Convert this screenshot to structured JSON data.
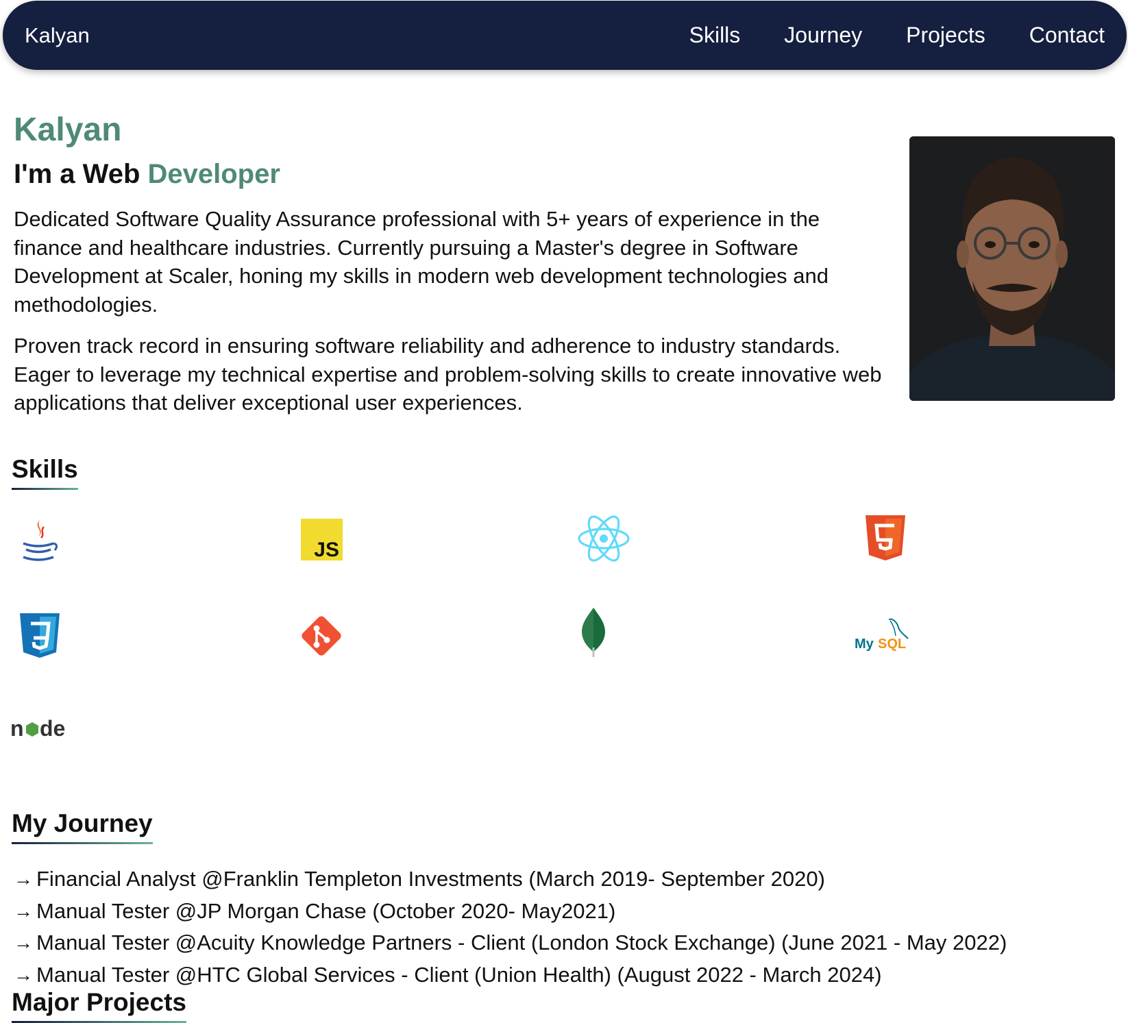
{
  "nav": {
    "brand": "Kalyan",
    "links": [
      "Skills",
      "Journey",
      "Projects",
      "Contact"
    ]
  },
  "hero": {
    "name": "Kalyan",
    "role_prefix": "I'm a Web ",
    "role_accent": "Developer",
    "bio_1": "Dedicated Software Quality Assurance professional with 5+ years of experience in the finance and healthcare industries. Currently pursuing a Master's degree in Software Development at Scaler, honing my skills in modern web development technologies and methodologies.",
    "bio_2": "Proven track record in ensuring software reliability and adherence to industry standards. Eager to leverage my technical expertise and problem-solving skills to create innovative web applications that deliver exceptional user experiences."
  },
  "skills": {
    "title": "Skills",
    "icons": [
      "java-icon",
      "javascript-icon",
      "react-icon",
      "html5-icon",
      "css3-icon",
      "git-icon",
      "mongodb-icon",
      "mysql-icon",
      "nodejs-icon"
    ],
    "js_label": "JS",
    "mysql_label_a": "My",
    "mysql_label_b": "SQL",
    "node_label_a": "n",
    "node_label_b": "de"
  },
  "journey": {
    "title": "My Journey",
    "arrow": "→",
    "items": [
      "Financial Analyst @Franklin Templeton Investments (March 2019- September 2020)",
      "Manual Tester @JP Morgan Chase (October 2020- May2021)",
      "Manual Tester @Acuity Knowledge Partners - Client (London Stock Exchange) (June 2021 - May 2022)",
      "Manual Tester @HTC Global Services - Client (Union Health) (August 2022 - March 2024)"
    ]
  },
  "next_section": {
    "title": "Major Projects"
  },
  "colors": {
    "navbar": "#151f3f",
    "accent": "#4f8a74",
    "text": "#111111"
  }
}
